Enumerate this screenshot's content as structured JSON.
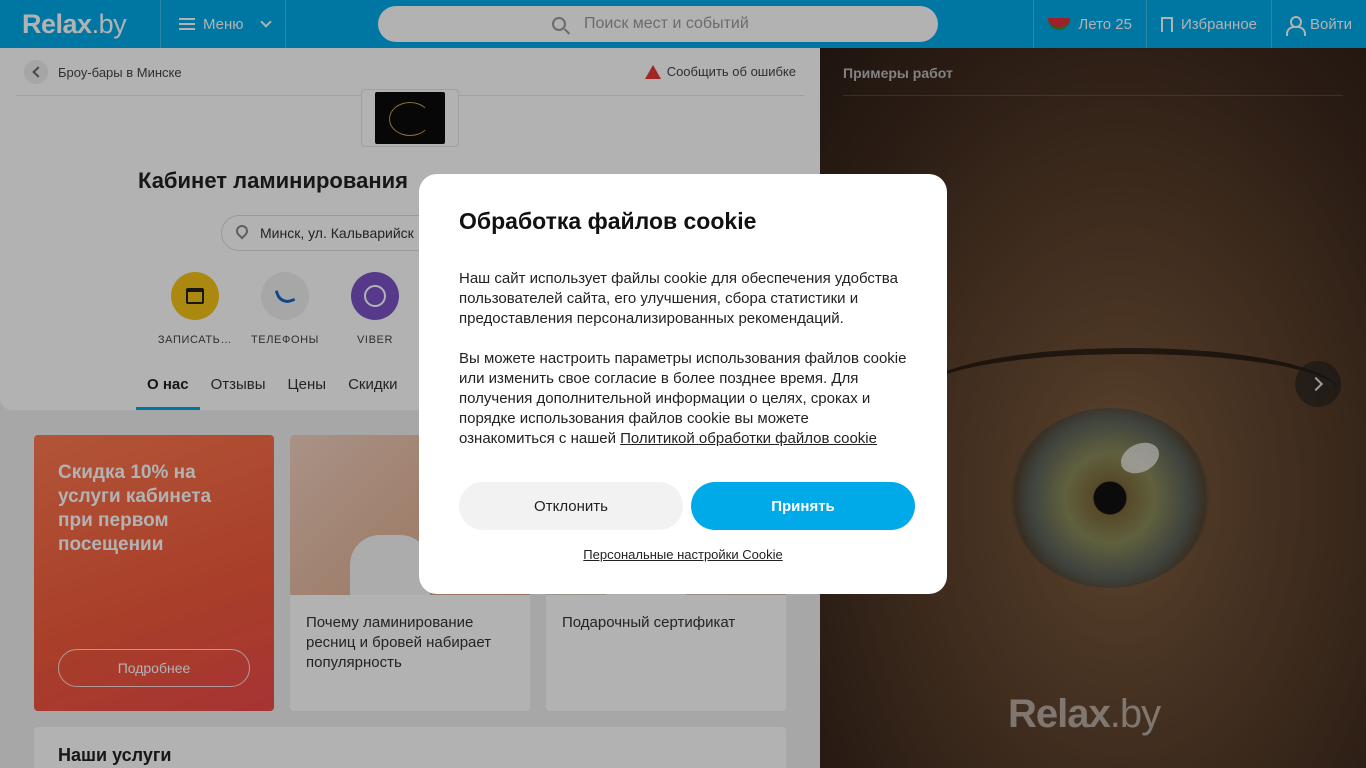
{
  "header": {
    "logo": "Relax",
    "logo_suffix": ".by",
    "menu_label": "Меню",
    "search_placeholder": "Поиск мест и событий",
    "summer_label": "Лето 25",
    "favorites_label": "Избранное",
    "login_label": "Войти",
    "brand_color": "#00a9e8"
  },
  "place": {
    "breadcrumb": "Броу-бары в Минске",
    "report_error": "Сообщить об ошибке",
    "title": "Кабинет ламинирования",
    "address": "Минск, ул. Кальварийск",
    "actions": [
      {
        "label": "ЗАПИСАТЬ…",
        "icon": "calendar-check-icon",
        "color": "#f5c518"
      },
      {
        "label": "ТЕЛЕФОНЫ",
        "icon": "phone-icon",
        "color": "#f0f0f0"
      },
      {
        "label": "VIBER",
        "icon": "viber-icon",
        "color": "#7b52c8"
      }
    ],
    "tabs": [
      "О нас",
      "Отзывы",
      "Цены",
      "Скидки"
    ]
  },
  "cards": {
    "promo_title": "Скидка 10% на услуги кабинета при первом посещении",
    "promo_button": "Подробнее",
    "article_title": "Почему ламинирование ресниц и бровей набирает популярность",
    "gift_title": "Подарочный сертификат",
    "services_heading": "Наши услуги"
  },
  "gallery": {
    "heading": "Примеры работ",
    "watermark": "Relax",
    "watermark_suffix": ".by"
  },
  "cookie_modal": {
    "title": "Обработка файлов cookie",
    "paragraph1": "Наш сайт использует файлы cookie для обеспечения удобства пользователей сайта, его улучшения, сбора статистики и предоставления персонализированных рекомендаций.",
    "paragraph2": "Вы можете настроить параметры использования файлов cookie или изменить свое согласие в более позднее время. Для получения дополнительной информации о целях, сроках и порядке использования файлов cookie вы можете ознакомиться с нашей",
    "policy_link": "Политикой обработки файлов cookie",
    "decline_button": "Отклонить",
    "accept_button": "Принять",
    "settings_link": "Персональные настройки Cookie"
  }
}
